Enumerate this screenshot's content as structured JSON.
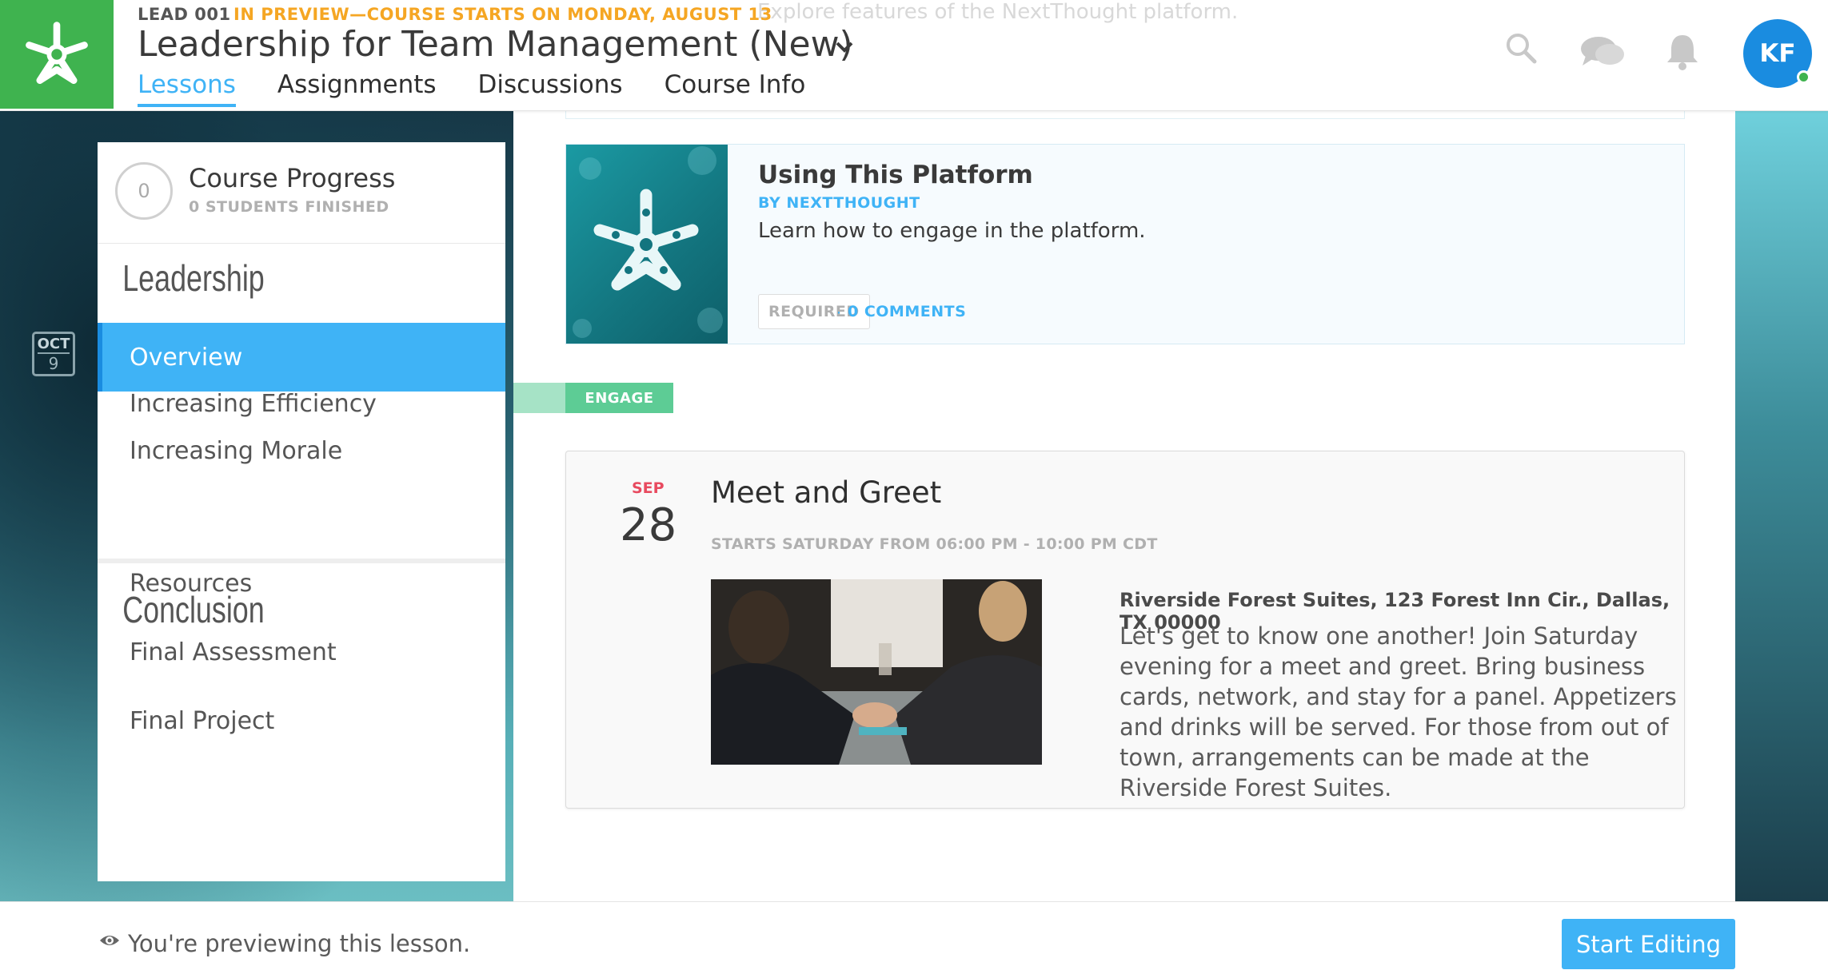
{
  "header": {
    "course_id": "LEAD 001",
    "preview_note": "IN PREVIEW—COURSE STARTS ON MONDAY, AUGUST 13",
    "course_title": "Leadership for Team Management (New)",
    "faded_text": "Explore features of the NextThought platform.",
    "tabs": [
      {
        "label": "Lessons",
        "active": true
      },
      {
        "label": "Assignments",
        "active": false
      },
      {
        "label": "Discussions",
        "active": false
      },
      {
        "label": "Course Info",
        "active": false
      }
    ],
    "icons": [
      "search-icon",
      "chat-icon",
      "bell-icon"
    ],
    "avatar_initials": "KF",
    "accent_color": "#3fb3f6",
    "brand_color": "#3fb34f"
  },
  "calendar_badge": {
    "month": "OCT",
    "day": "9"
  },
  "sidebar": {
    "progress": {
      "value": "0",
      "title": "Course Progress",
      "subtitle": "0 STUDENTS FINISHED"
    },
    "units": [
      {
        "title": "Leadership",
        "items": [
          {
            "label": "Overview",
            "active": true
          },
          {
            "label": "Increasing Efficiency",
            "active": false
          },
          {
            "label": "Increasing Morale",
            "active": false
          }
        ]
      },
      {
        "title": "Conclusion",
        "items": [
          {
            "label": "Resources",
            "active": false
          },
          {
            "label": "Final Assessment",
            "active": false
          },
          {
            "label": "Final Project",
            "active": false
          }
        ]
      }
    ]
  },
  "main": {
    "platform_card": {
      "title": "Using This Platform",
      "author": "BY NEXTTHOUGHT",
      "description": "Learn how to engage in the platform.",
      "required": "REQUIRED",
      "comments": "0 COMMENTS"
    },
    "section_label": "ENGAGE",
    "event": {
      "month": "SEP",
      "day": "28",
      "title": "Meet and Greet",
      "time": "STARTS SATURDAY FROM 06:00 PM - 10:00 PM CDT",
      "location": "Riverside Forest Suites, 123 Forest Inn Cir., Dallas, TX 00000",
      "description": "Let's get to know one another! Join Saturday evening for a meet and greet. Bring business cards, network, and stay for a panel. Appetizers and drinks will be served. For those from out of town, arrangements can be made at the Riverside Forest Suites."
    }
  },
  "footer": {
    "preview_message": "You're previewing this lesson.",
    "start_editing_label": "Start Editing"
  }
}
